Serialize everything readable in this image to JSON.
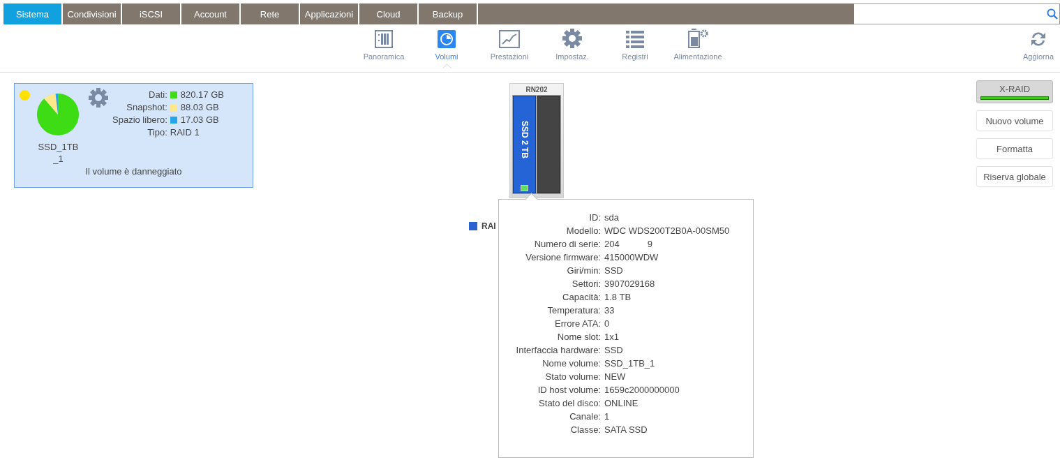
{
  "nav_tabs": [
    {
      "label": "Sistema",
      "selected": true
    },
    {
      "label": "Condivisioni",
      "selected": false
    },
    {
      "label": "iSCSI",
      "selected": false
    },
    {
      "label": "Account",
      "selected": false
    },
    {
      "label": "Rete",
      "selected": false
    },
    {
      "label": "Applicazioni",
      "selected": false
    },
    {
      "label": "Cloud",
      "selected": false
    },
    {
      "label": "Backup",
      "selected": false
    }
  ],
  "toolbar": [
    {
      "label": "Panoramica",
      "kind": "overview",
      "selected": false
    },
    {
      "label": "Volumi",
      "kind": "volumes",
      "selected": true
    },
    {
      "label": "Prestazioni",
      "kind": "performance",
      "selected": false
    },
    {
      "label": "Impostaz.",
      "kind": "settings",
      "selected": false
    },
    {
      "label": "Registri",
      "kind": "logs",
      "selected": false
    },
    {
      "label": "Alimentazione",
      "kind": "power",
      "selected": false
    }
  ],
  "refresh": {
    "label": "Aggiorna"
  },
  "volume": {
    "name": "SSD_1TB\n_1",
    "status_dot": {
      "color": "#ffe100"
    },
    "status_text": "Il volume è danneggiato",
    "legend": [
      {
        "label": "Dati:",
        "value": "820.17 GB",
        "color": "#3ddc14"
      },
      {
        "label": "Snapshot:",
        "value": "88.03 GB",
        "color": "#fde98a"
      },
      {
        "label": "Spazio libero:",
        "value": "17.03 GB",
        "color": "#28a4e8"
      }
    ],
    "type_label": "Tipo:",
    "type_value": "RAID 1"
  },
  "enclosure": {
    "title": "RN202",
    "disk_label": "SSD 2 TB",
    "legend": "RAI"
  },
  "tooltip": [
    {
      "label": "ID:",
      "values": [
        "sda"
      ]
    },
    {
      "label": "Modello:",
      "values": [
        "WDC WDS200T2B0A-00SM50"
      ]
    },
    {
      "label": "Numero di serie:",
      "values": [
        "204",
        "9"
      ]
    },
    {
      "label": "Versione firmware:",
      "values": [
        "415000WDW"
      ]
    },
    {
      "label": "Giri/min:",
      "values": [
        "SSD"
      ]
    },
    {
      "label": "Settori:",
      "values": [
        "3907029168"
      ]
    },
    {
      "label": "Capacità:",
      "values": [
        "1.8 TB"
      ]
    },
    {
      "label": "Temperatura:",
      "values": [
        "33"
      ]
    },
    {
      "label": "Errore ATA:",
      "values": [
        "0"
      ]
    },
    {
      "label": "Nome slot:",
      "values": [
        "1x1"
      ]
    },
    {
      "label": "Interfaccia hardware:",
      "values": [
        "SSD"
      ]
    },
    {
      "label": "Nome volume:",
      "values": [
        "SSD_1TB_1"
      ]
    },
    {
      "label": "Stato volume:",
      "values": [
        "NEW"
      ]
    },
    {
      "label": "ID host volume:",
      "values": [
        "1659c2000000000"
      ]
    },
    {
      "label": "Stato del disco:",
      "values": [
        "ONLINE"
      ]
    },
    {
      "label": "Canale:",
      "values": [
        "1"
      ]
    },
    {
      "label": "Classe:",
      "values": [
        "SATA SSD"
      ]
    }
  ],
  "actions": [
    {
      "label": "X-RAID",
      "kind": "xraid",
      "on": true
    },
    {
      "label": "Nuovo volume",
      "kind": "plain"
    },
    {
      "label": "Formatta",
      "kind": "plain"
    },
    {
      "label": "Riserva globale",
      "kind": "plain"
    }
  ]
}
